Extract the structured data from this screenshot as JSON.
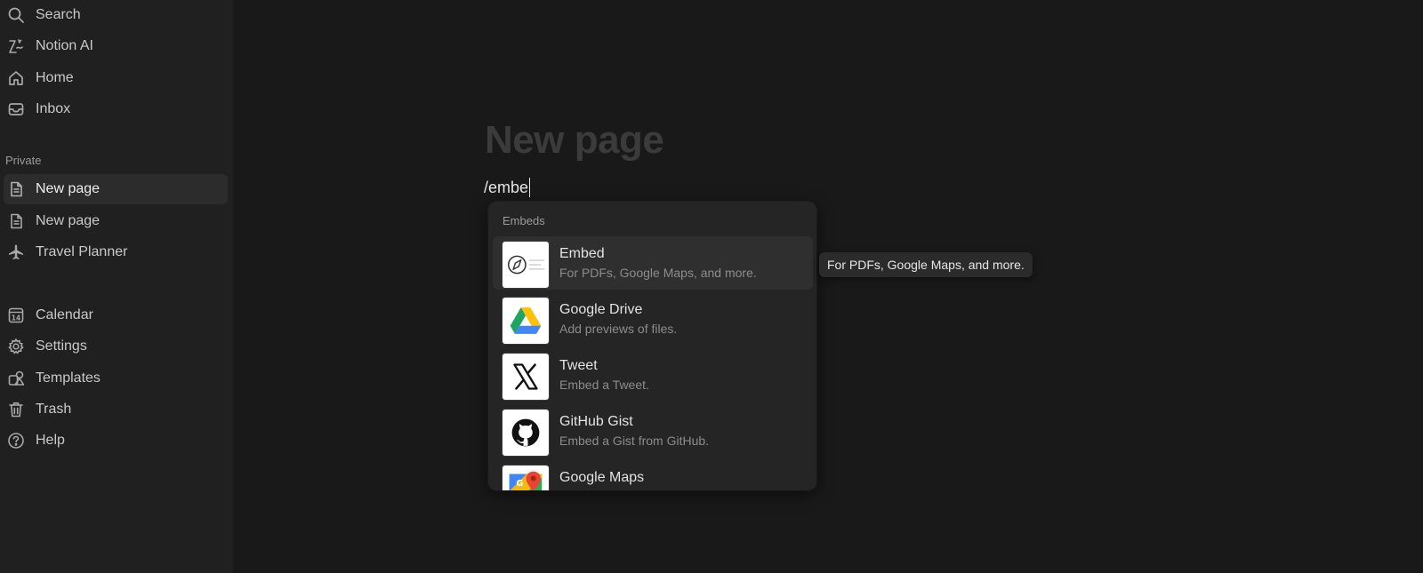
{
  "sidebar": {
    "top_items": [
      {
        "label": "Search",
        "icon": "search-icon"
      },
      {
        "label": "Notion AI",
        "icon": "notion-ai-icon"
      },
      {
        "label": "Home",
        "icon": "home-icon"
      },
      {
        "label": "Inbox",
        "icon": "inbox-icon"
      }
    ],
    "section_label": "Private",
    "pages": [
      {
        "label": "New page",
        "icon": "page-icon",
        "active": true
      },
      {
        "label": "New page",
        "icon": "page-icon",
        "active": false
      },
      {
        "label": "Travel Planner",
        "icon": "airplane-icon",
        "active": false
      }
    ],
    "bottom_items": [
      {
        "label": "Calendar",
        "icon": "calendar-icon",
        "badge": "14"
      },
      {
        "label": "Settings",
        "icon": "gear-icon"
      },
      {
        "label": "Templates",
        "icon": "templates-icon"
      },
      {
        "label": "Trash",
        "icon": "trash-icon"
      },
      {
        "label": "Help",
        "icon": "help-icon"
      }
    ]
  },
  "main": {
    "page_title": "New page",
    "command_text": "/embe"
  },
  "menu": {
    "header": "Embeds",
    "items": [
      {
        "title": "Embed",
        "description": "For PDFs, Google Maps, and more.",
        "icon": "compass-embed-icon"
      },
      {
        "title": "Google Drive",
        "description": "Add previews of files.",
        "icon": "google-drive-icon"
      },
      {
        "title": "Tweet",
        "description": "Embed a Tweet.",
        "icon": "x-logo-icon"
      },
      {
        "title": "GitHub Gist",
        "description": "Embed a Gist from GitHub.",
        "icon": "github-icon"
      },
      {
        "title": "Google Maps",
        "description": "",
        "icon": "google-maps-icon"
      }
    ]
  },
  "tooltip": {
    "text": "For PDFs, Google Maps, and more."
  },
  "colors": {
    "background": "#191919",
    "sidebar": "#202020",
    "menu": "#252525",
    "highlight": "#2f2f2f"
  }
}
